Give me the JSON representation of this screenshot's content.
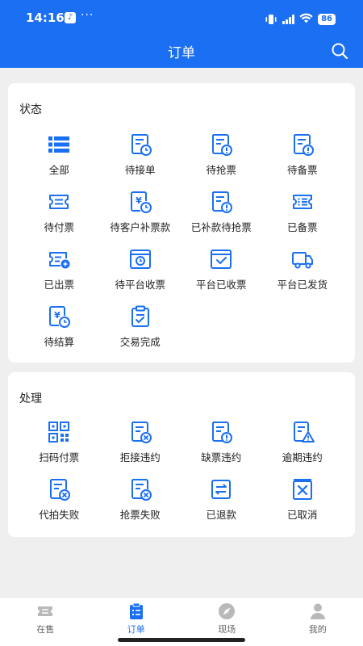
{
  "status_bar": {
    "time": "14:16",
    "dots": "···",
    "battery": "86"
  },
  "header": {
    "title": "订单"
  },
  "colors": {
    "accent": "#1a6ff2",
    "background": "#efefef"
  },
  "status_section": {
    "title": "状态",
    "items": [
      {
        "label": "全部",
        "icon": "list-icon"
      },
      {
        "label": "待接单",
        "icon": "document-clock-icon"
      },
      {
        "label": "待抢票",
        "icon": "document-alert-icon"
      },
      {
        "label": "待备票",
        "icon": "document-alert-icon"
      },
      {
        "label": "待付票",
        "icon": "ticket-icon"
      },
      {
        "label": "待客户补票款",
        "icon": "yuan-clock-icon"
      },
      {
        "label": "已补款待抢票",
        "icon": "document-alert-icon"
      },
      {
        "label": "已备票",
        "icon": "ticket-list-icon"
      },
      {
        "label": "已出票",
        "icon": "ticket-out-icon"
      },
      {
        "label": "待平台收票",
        "icon": "tray-clock-icon"
      },
      {
        "label": "平台已收票",
        "icon": "tray-check-icon"
      },
      {
        "label": "平台已发货",
        "icon": "truck-icon"
      },
      {
        "label": "待结算",
        "icon": "yuan-clock-icon"
      },
      {
        "label": "交易完成",
        "icon": "clipboard-check-icon"
      }
    ]
  },
  "handle_section": {
    "title": "处理",
    "items": [
      {
        "label": "扫码付票",
        "icon": "qr-code-icon"
      },
      {
        "label": "拒接违约",
        "icon": "document-x-icon"
      },
      {
        "label": "缺票违约",
        "icon": "document-alert-icon"
      },
      {
        "label": "逾期违约",
        "icon": "document-warning-icon"
      },
      {
        "label": "代拍失败",
        "icon": "document-x-icon"
      },
      {
        "label": "抢票失败",
        "icon": "document-x-icon"
      },
      {
        "label": "已退款",
        "icon": "refund-icon"
      },
      {
        "label": "已取消",
        "icon": "cancel-icon"
      }
    ]
  },
  "tabbar": {
    "tabs": [
      {
        "label": "在售",
        "icon": "ticket-tab-icon",
        "active": false
      },
      {
        "label": "订单",
        "icon": "orders-tab-icon",
        "active": true
      },
      {
        "label": "现场",
        "icon": "location-tab-icon",
        "active": false
      },
      {
        "label": "我的",
        "icon": "user-tab-icon",
        "active": false
      }
    ]
  }
}
